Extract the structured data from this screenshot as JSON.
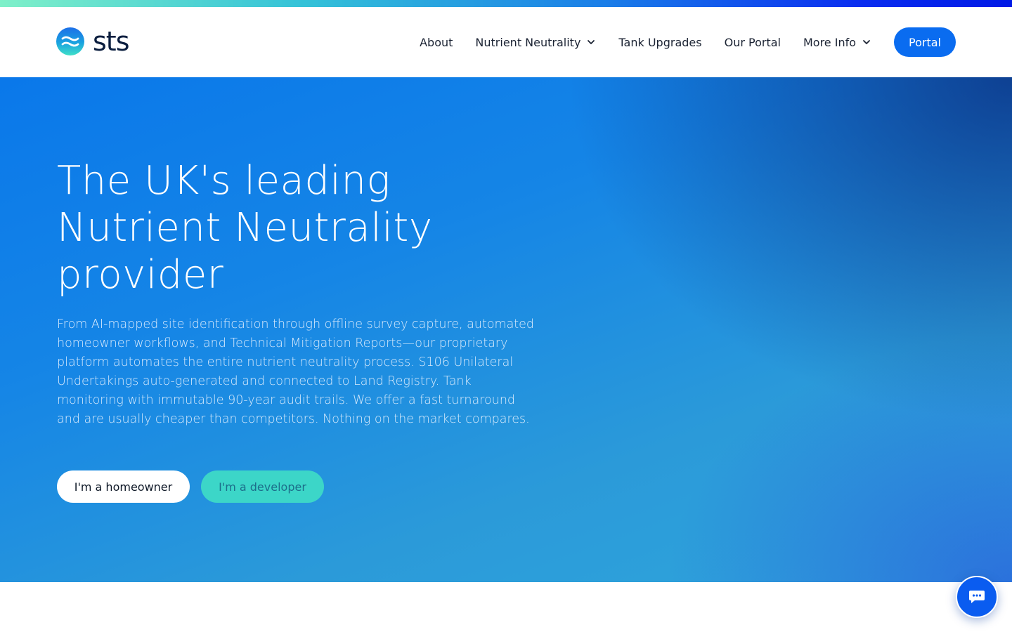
{
  "brand": {
    "name": "sts",
    "colors": {
      "primary": "#0a6cf0",
      "accent": "#3cd6c8",
      "dark_text": "#0b1e3f"
    }
  },
  "nav": {
    "items": [
      {
        "label": "About",
        "has_dropdown": false
      },
      {
        "label": "Nutrient Neutrality",
        "has_dropdown": true
      },
      {
        "label": "Tank Upgrades",
        "has_dropdown": false
      },
      {
        "label": "Our Portal",
        "has_dropdown": false
      },
      {
        "label": "More Info",
        "has_dropdown": true
      }
    ],
    "cta_label": "Portal"
  },
  "hero": {
    "title": "The UK's leading Nutrient Neutrality provider",
    "description": "From AI-mapped site identification through offline survey capture, automated homeowner workflows, and Technical Mitigation Reports—our proprietary platform automates the entire nutrient neutrality process. S106 Unilateral Undertakings auto-generated and connected to Land Registry. Tank monitoring with immutable 90-year audit trails. We offer a fast turnaround and are usually cheaper than competitors. Nothing on the market compares.",
    "buttons": {
      "homeowner": "I'm a homeowner",
      "developer": "I'm a developer"
    }
  },
  "chat": {
    "icon": "chat-bubble-icon"
  }
}
